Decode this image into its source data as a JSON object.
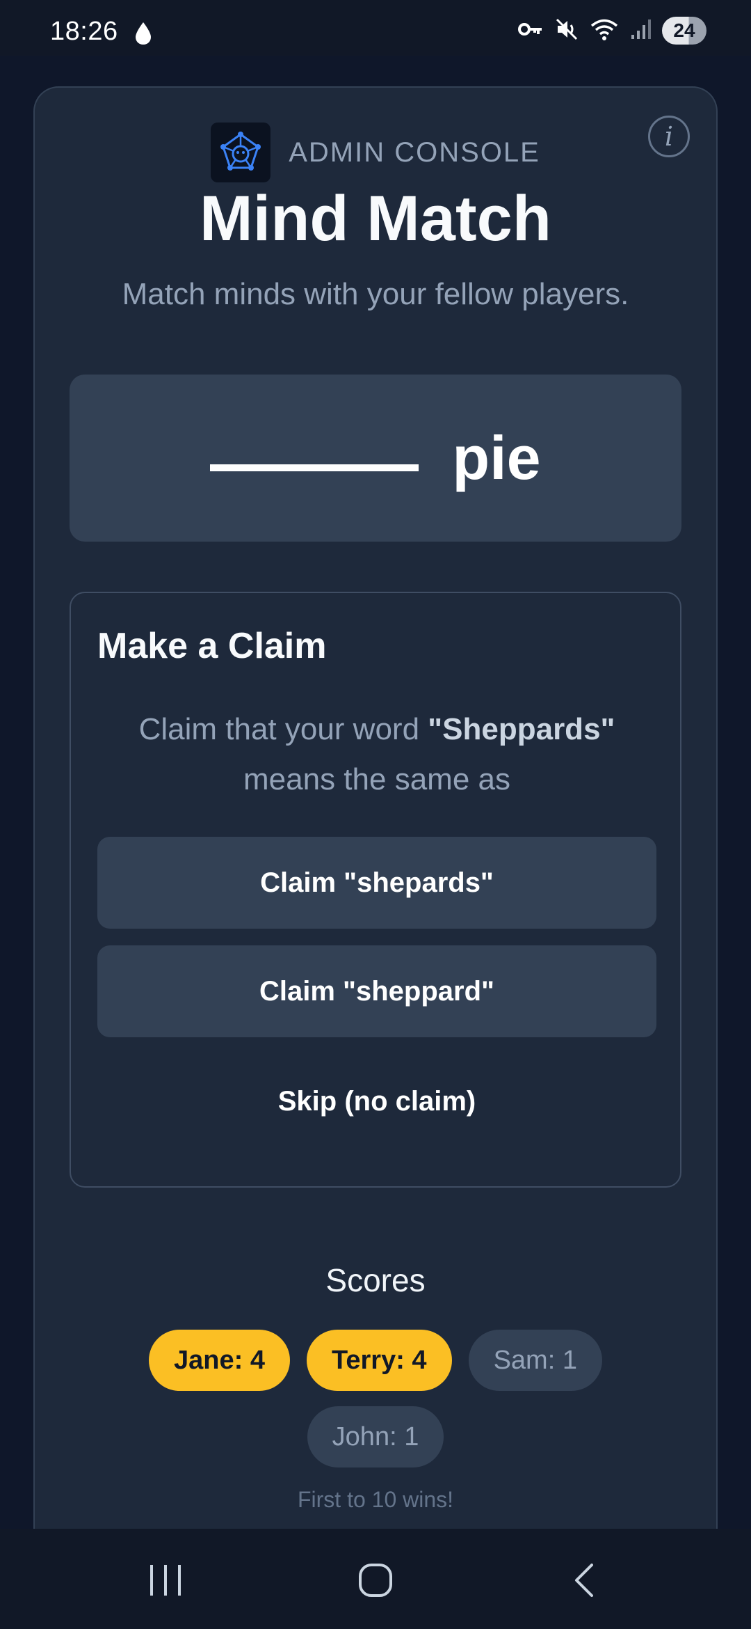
{
  "status_bar": {
    "time": "18:26",
    "battery_level": "24",
    "icons": [
      "drop-icon",
      "key-icon",
      "mute-icon",
      "wifi-icon",
      "signal-icon"
    ]
  },
  "app": {
    "admin_label": "ADMIN CONSOLE",
    "title": "Mind Match",
    "subtitle": "Match minds with your fellow players.",
    "info_symbol": "i"
  },
  "prompt": {
    "word": "pie"
  },
  "claim": {
    "heading": "Make a Claim",
    "text_before": "Claim that your word ",
    "word": "\"Sheppards\"",
    "text_after": " means the same as",
    "options": [
      "Claim \"shepards\"",
      "Claim \"sheppard\""
    ],
    "skip_label": "Skip (no claim)"
  },
  "scores": {
    "heading": "Scores",
    "players": [
      {
        "label": "Jane: 4",
        "leading": true
      },
      {
        "label": "Terry: 4",
        "leading": true
      },
      {
        "label": "Sam: 1",
        "leading": false
      },
      {
        "label": "John: 1",
        "leading": false
      }
    ],
    "footnote": "First to 10 wins!"
  },
  "colors": {
    "background": "#0f172a",
    "card": "#1e293b",
    "surface": "#334155",
    "leader_chip": "#fbbf24",
    "logo_accent": "#3b82f6"
  }
}
